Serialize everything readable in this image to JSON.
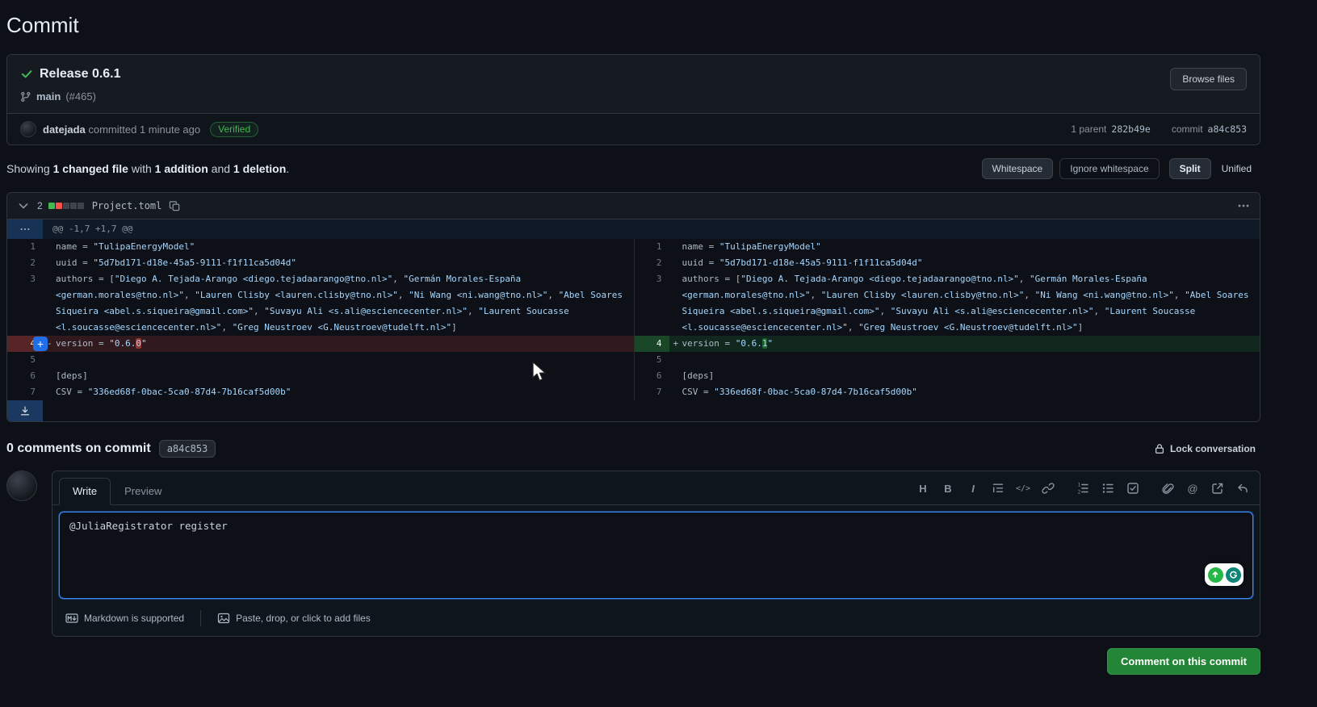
{
  "colors": {
    "page_bg": "#0d1117",
    "panel_bg": "#161b22",
    "border": "#30363d",
    "accent_blue": "#388bfd",
    "success_green": "#238636",
    "verified_green": "#3fb950",
    "deletion_red": "#f85149",
    "code_string_blue": "#a5d6ff"
  },
  "page": {
    "title": "Commit"
  },
  "commit": {
    "title": "Release 0.6.1",
    "branch": "main",
    "issue_ref": "(#465)",
    "browse_files_label": "Browse files",
    "author": "datejada",
    "committed": "committed 1 minute ago",
    "verified": "Verified",
    "parent_label": "1 parent",
    "parent_sha": "282b49e",
    "commit_label": "commit",
    "commit_sha": "a84c853"
  },
  "summary": {
    "showing": "Showing",
    "changed_files": "1 changed file",
    "with_word": "with",
    "additions": "1 addition",
    "and_word": "and",
    "deletions": "1 deletion",
    "period": ".",
    "whitespace_label": "Whitespace",
    "ignore_whitespace_label": "Ignore whitespace",
    "split_label": "Split",
    "unified_label": "Unified"
  },
  "diff": {
    "changes_count": "2",
    "stat_squares": [
      "addition",
      "deletion",
      "neutral",
      "neutral",
      "neutral"
    ],
    "filename": "Project.toml",
    "hunk_header": "@@ -1,7 +1,7 @@",
    "rows": [
      {
        "type": "ctx",
        "n": "1",
        "segs": [
          {
            "t": "name = "
          },
          {
            "t": "\"TulipaEnergyModel\"",
            "c": "s"
          }
        ]
      },
      {
        "type": "ctx",
        "n": "2",
        "segs": [
          {
            "t": "uuid = "
          },
          {
            "t": "\"5d7bd171-d18e-45a5-9111-f1f11ca5d04d\"",
            "c": "s"
          }
        ]
      },
      {
        "type": "ctx",
        "n": "3",
        "segs": [
          {
            "t": "authors = ["
          },
          {
            "t": "\"Diego A. Tejada-Arango <diego.tejadaarango@tno.nl>\"",
            "c": "s"
          },
          {
            "t": ", "
          },
          {
            "t": "\"Germán Morales-España <german.morales@tno.nl>\"",
            "c": "s"
          },
          {
            "t": ", "
          },
          {
            "t": "\"Lauren Clisby <lauren.clisby@tno.nl>\"",
            "c": "s"
          },
          {
            "t": ", "
          },
          {
            "t": "\"Ni Wang <ni.wang@tno.nl>\"",
            "c": "s"
          },
          {
            "t": ", "
          },
          {
            "t": "\"Abel Soares Siqueira <abel.s.siqueira@gmail.com>\"",
            "c": "s"
          },
          {
            "t": ", "
          },
          {
            "t": "\"Suvayu Ali <s.ali@esciencecenter.nl>\"",
            "c": "s"
          },
          {
            "t": ", "
          },
          {
            "t": "\"Laurent Soucasse <l.soucasse@esciencecenter.nl>\"",
            "c": "s"
          },
          {
            "t": ", "
          },
          {
            "t": "\"Greg Neustroev <G.Neustroev@tudelft.nl>\"",
            "c": "s"
          },
          {
            "t": "]"
          }
        ]
      },
      {
        "type": "change",
        "n": "4",
        "left": [
          {
            "t": "version = "
          },
          {
            "t": "\"0.6.",
            "c": "s"
          },
          {
            "t": "0",
            "c": "s hd"
          },
          {
            "t": "\"",
            "c": "s"
          }
        ],
        "right": [
          {
            "t": "version = "
          },
          {
            "t": "\"0.6.",
            "c": "s"
          },
          {
            "t": "1",
            "c": "s ha"
          },
          {
            "t": "\"",
            "c": "s"
          }
        ]
      },
      {
        "type": "ctx",
        "n": "5",
        "segs": []
      },
      {
        "type": "ctx",
        "n": "6",
        "segs": [
          {
            "t": "[deps]"
          }
        ]
      },
      {
        "type": "ctx",
        "n": "7",
        "segs": [
          {
            "t": "CSV = "
          },
          {
            "t": "\"336ed68f-0bac-5ca0-87d4-7b16caf5d00b\"",
            "c": "s"
          }
        ]
      }
    ]
  },
  "comments": {
    "heading": "0 comments on commit",
    "sha_badge": "a84c853",
    "lock_label": "Lock conversation"
  },
  "composer": {
    "tabs": [
      {
        "label": "Write"
      },
      {
        "label": "Preview"
      }
    ],
    "toolbar": [
      "heading",
      "bold",
      "italic",
      "quote",
      "code",
      "link",
      "numbered-list",
      "unordered-list",
      "tasklist",
      "attach-file",
      "mention",
      "cross-reference",
      "saved-replies"
    ],
    "textarea_value": "@JuliaRegistrator register",
    "footer_markdown": "Markdown is supported",
    "footer_paste": "Paste, drop, or click to add files",
    "submit_label": "Comment on this commit"
  }
}
